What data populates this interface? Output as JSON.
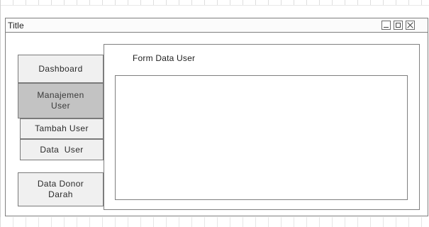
{
  "window": {
    "title": "Title"
  },
  "sidebar": {
    "items": [
      {
        "label": "Dashboard",
        "active": false
      },
      {
        "label": "Manajemen User",
        "active": true
      },
      {
        "label": "Tambah User",
        "active": false
      },
      {
        "label": "Data  User",
        "active": false
      },
      {
        "label": "Data Donor Darah",
        "active": false
      }
    ]
  },
  "main": {
    "form_title": "Form Data User"
  },
  "colors": {
    "border": "#7f7f7f",
    "button_bg": "#f0f0f0",
    "active_bg": "#c3c3c3"
  },
  "icons": {
    "minimize": "minimize-icon",
    "maximize": "maximize-icon",
    "close": "close-icon"
  }
}
